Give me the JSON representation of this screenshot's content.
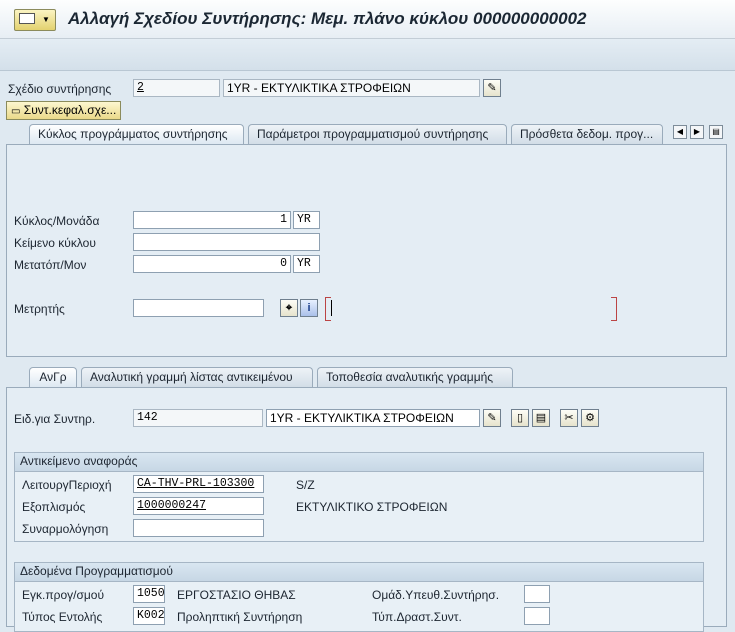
{
  "title": "Αλλαγή Σχεδίου Συντήρησης: Μεμ. πλάνο κύκλου 000000000002",
  "header": {
    "plan_label": "Σχέδιο συντήρησης",
    "plan_number": "2",
    "plan_text": "1YR - ΕΚΤΥΛΙΚΤΙΚΑ ΣΤΡΟΦΕΙΩΝ",
    "header_button": "Συντ.κεφαλ.σχε..."
  },
  "tabs": [
    "Κύκλος προγράμματος συντήρησης",
    "Παράμετροι προγραμματισμού συντήρησης",
    "Πρόσθετα δεδομ. προγ..."
  ],
  "cycle": {
    "cycle_label": "Κύκλος/Μονάδα",
    "cycle_value": "1",
    "cycle_unit": "YR",
    "text_label": "Κείμενο κύκλου",
    "text_value": "",
    "offset_label": "Μετατόπ/Μον",
    "offset_value": "0",
    "offset_unit": "YR",
    "counter_label": "Μετρητής",
    "counter_value": ""
  },
  "item_tabs": [
    "ΑνΓρ",
    "Αναλυτική γραμμή λίστας αντικειμένου",
    "Τοποθεσία αναλυτικής γραμμής"
  ],
  "item": {
    "label": "Ειδ.για Συντηρ.",
    "number": "142",
    "text": "1YR - ΕΚΤΥΛΙΚΤΙΚΑ ΣΤΡΟΦΕΙΩΝ"
  },
  "ref_object": {
    "header": "Αντικείμενο αναφοράς",
    "floc_label": "ΛειτουργΠεριοχή",
    "floc_value": "CA-THV-PRL-103300",
    "floc_desc": "S/Z",
    "equip_label": "Εξοπλισμός",
    "equip_value": "1000000247",
    "equip_desc": "ΕΚΤΥΛΙΚΤΙΚΟ ΣΤΡΟΦΕΙΩΝ",
    "assembly_label": "Συναρμολόγηση",
    "assembly_value": ""
  },
  "planning": {
    "header": "Δεδομένα Προγραμματισμού",
    "plant_label": "Εγκ.προγ/σμού",
    "plant_value": "1050",
    "plant_desc": "ΕΡΓΟΣΤΑΣΙΟ ΘΗΒΑΣ",
    "group_label": "Ομάδ.Υπευθ.Συντήρησ.",
    "group_value": "",
    "order_label": "Τύπος Εντολής",
    "order_value": "K002",
    "order_desc": "Προληπτική Συντήρηση",
    "activity_label": "Τύπ.Δραστ.Συντ.",
    "activity_value": ""
  }
}
